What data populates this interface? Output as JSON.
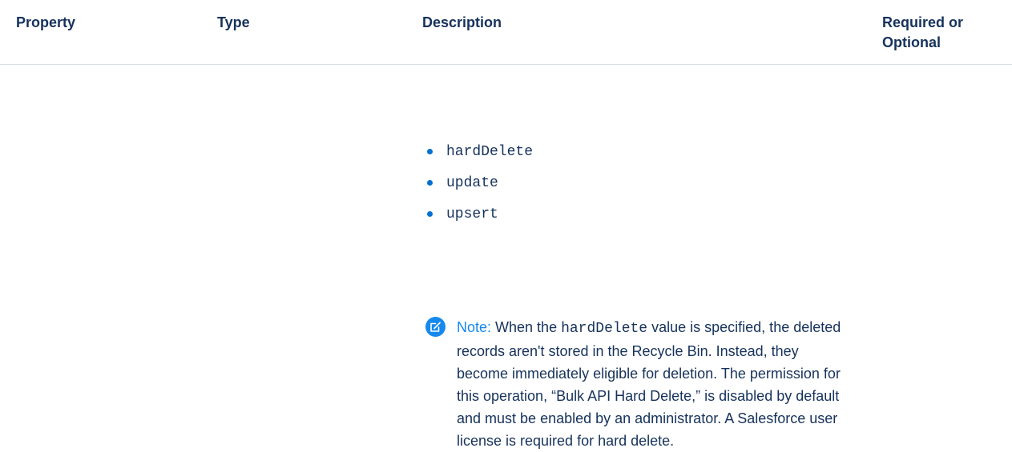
{
  "table": {
    "headers": {
      "property": "Property",
      "type": "Type",
      "description": "Description",
      "required_line1": "Required or",
      "required_line2": "Optional"
    },
    "description_values": [
      "hardDelete",
      "update",
      "upsert"
    ],
    "note": {
      "label": "Note:",
      "text_before": " When the ",
      "code": "hardDelete",
      "text_after": " value is specified, the deleted records aren't stored in the Recycle Bin. Instead, they become immediately eligible for deletion. The permission for this operation, “Bulk API Hard Delete,” is disabled by default and must be enabled by an administrator. A Salesforce user license is required for hard delete."
    }
  },
  "colors": {
    "text": "#16325c",
    "accent": "#1589ee",
    "bullet": "#0070d2",
    "divider": "#d8dde6"
  },
  "icons": {
    "note": "edit-note-icon"
  }
}
